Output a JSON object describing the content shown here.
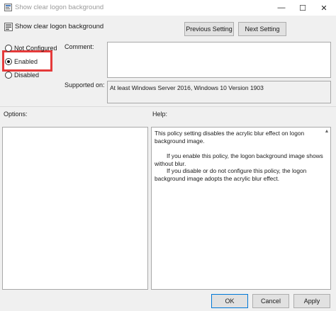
{
  "window": {
    "title": "Show clear logon background",
    "minimize_glyph": "—",
    "maximize_glyph": "☐",
    "close_glyph": "✕"
  },
  "header": {
    "policy_title": "Show clear logon background",
    "previous_label": "Previous Setting",
    "next_label": "Next Setting"
  },
  "state": {
    "options": [
      {
        "label": "Not Configured",
        "checked": false
      },
      {
        "label": "Enabled",
        "checked": true
      },
      {
        "label": "Disabled",
        "checked": false
      }
    ],
    "highlight_color": "#e53a3a"
  },
  "fields": {
    "comment_label": "Comment:",
    "comment_value": "",
    "supported_label": "Supported on:",
    "supported_value": "At least Windows Server 2016, Windows 10 Version 1903"
  },
  "panels": {
    "options_label": "Options:",
    "help_label": "Help:",
    "help_paragraphs": [
      "This policy setting disables the acrylic blur effect on logon background image.",
      "If you enable this policy, the logon background image shows without blur.",
      "If you disable or do not configure this policy, the logon background image adopts the acrylic blur effect."
    ]
  },
  "footer": {
    "ok_label": "OK",
    "cancel_label": "Cancel",
    "apply_label": "Apply"
  }
}
